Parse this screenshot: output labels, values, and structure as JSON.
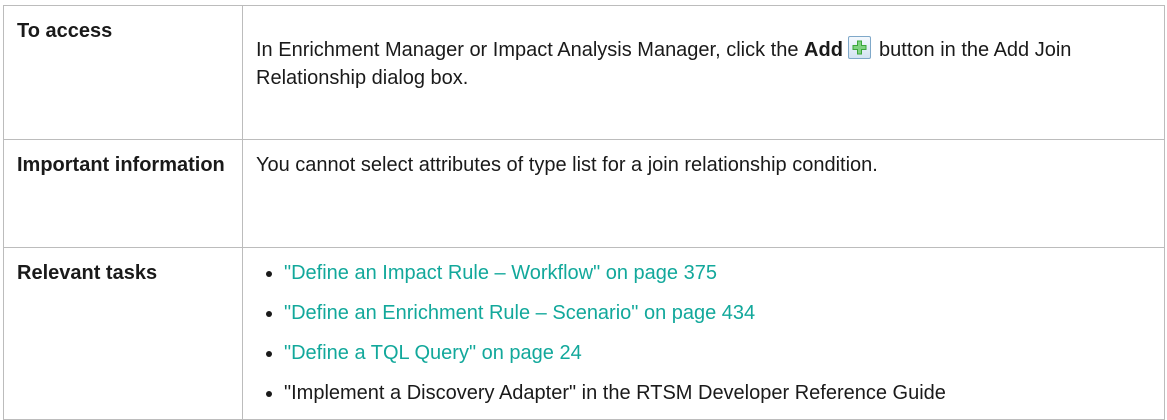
{
  "rows": {
    "access": {
      "label": "To access",
      "text_before": "In Enrichment Manager or Impact Analysis Manager, click the ",
      "button_label": "Add",
      "text_after": " button in the Add Join Relationship dialog box."
    },
    "important": {
      "label": "Important information",
      "text": "You cannot select attributes of type list for a join relationship condition."
    },
    "tasks": {
      "label": "Relevant tasks",
      "items": [
        {
          "link": "\"Define an Impact Rule – Workflow\" on page 375"
        },
        {
          "link": "\"Define an Enrichment Rule – Scenario\" on page 434"
        },
        {
          "link": "\"Define a TQL Query\" on page 24"
        },
        {
          "text": "\"Implement a Discovery Adapter\" in the RTSM Developer Reference Guide"
        }
      ]
    }
  },
  "icons": {
    "add_button_icon": "plus-icon"
  },
  "colors": {
    "link": "#12a89b",
    "border": "#bcbcbc",
    "plus": "#3aa63a"
  }
}
